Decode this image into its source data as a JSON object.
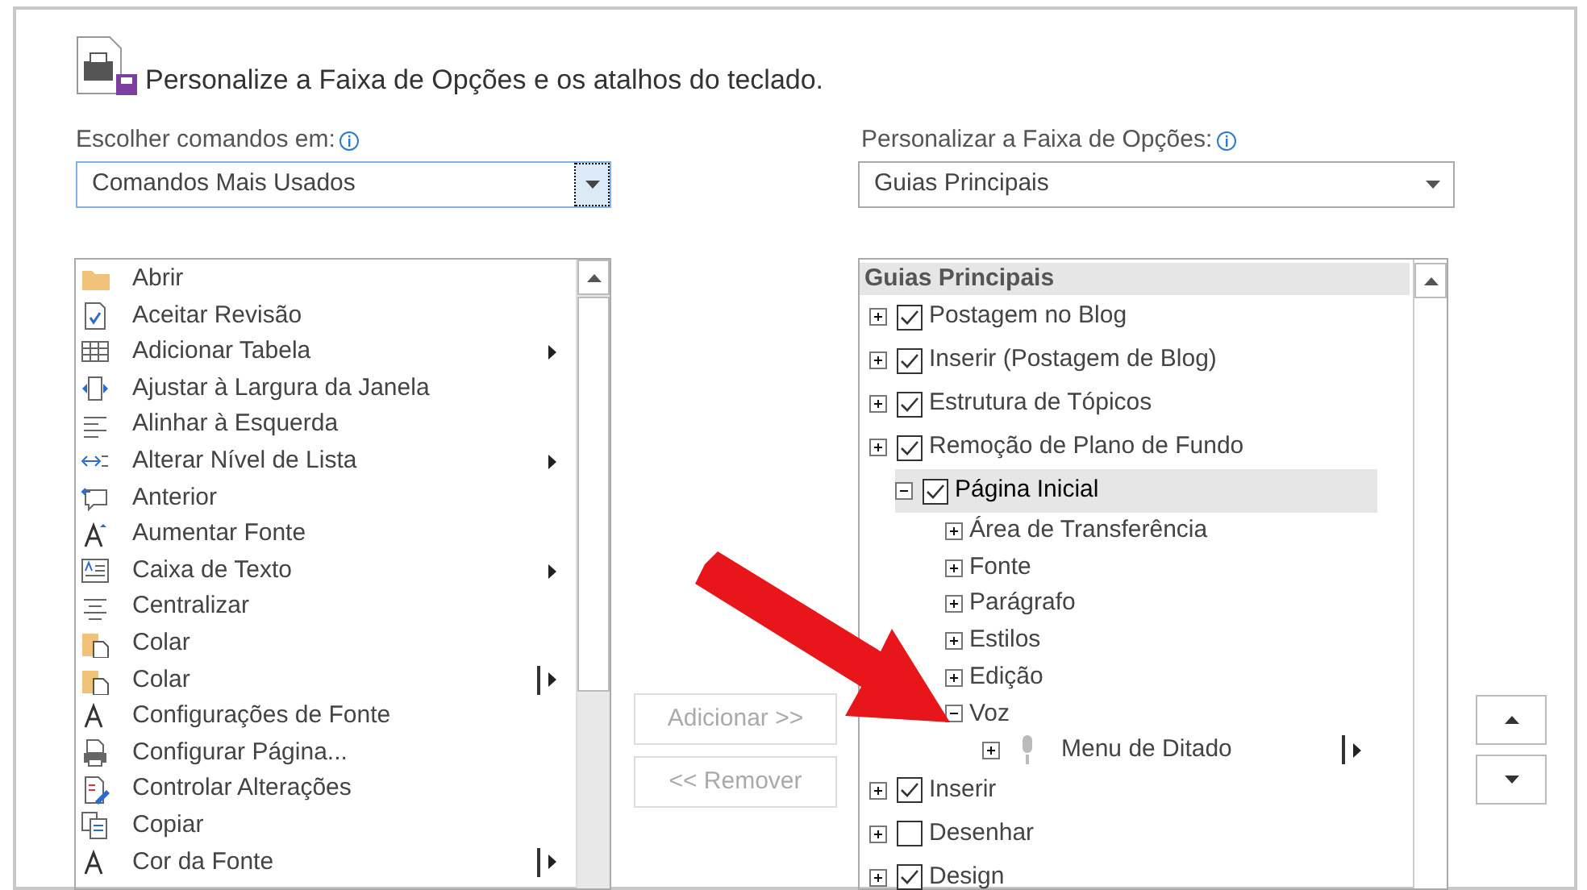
{
  "header": {
    "title": "Personalize a Faixa de Opções e os atalhos do teclado."
  },
  "commands_source": {
    "label": "Escolher comandos em:",
    "value": "Comandos Mais Usados"
  },
  "ribbon_target": {
    "label": "Personalizar a Faixa de Opções:",
    "value": "Guias Principais"
  },
  "commands": [
    {
      "label": "Abrir",
      "kind": "plain"
    },
    {
      "label": "Aceitar Revisão",
      "kind": "plain"
    },
    {
      "label": "Adicionar Tabela",
      "kind": "submenu"
    },
    {
      "label": "Ajustar à Largura da Janela",
      "kind": "plain"
    },
    {
      "label": "Alinhar à Esquerda",
      "kind": "plain"
    },
    {
      "label": "Alterar Nível de Lista",
      "kind": "submenu"
    },
    {
      "label": "Anterior",
      "kind": "plain"
    },
    {
      "label": "Aumentar Fonte",
      "kind": "plain"
    },
    {
      "label": "Caixa de Texto",
      "kind": "submenu"
    },
    {
      "label": "Centralizar",
      "kind": "plain"
    },
    {
      "label": "Colar",
      "kind": "plain"
    },
    {
      "label": "Colar",
      "kind": "split"
    },
    {
      "label": "Configurações de Fonte",
      "kind": "plain"
    },
    {
      "label": "Configurar Página...",
      "kind": "plain"
    },
    {
      "label": "Controlar Alterações",
      "kind": "plain"
    },
    {
      "label": "Copiar",
      "kind": "plain"
    },
    {
      "label": "Cor da Fonte",
      "kind": "split"
    }
  ],
  "actions": [
    {
      "label": "Adicionar >>",
      "disabled": true
    },
    {
      "label": "<< Remover",
      "disabled": true
    }
  ],
  "tree": {
    "heading": "Guias Principais",
    "items": [
      {
        "kind": "tab",
        "label": "Postagem no Blog",
        "checked": true,
        "expanded": false,
        "selected": false
      },
      {
        "kind": "tab",
        "label": "Inserir (Postagem de Blog)",
        "checked": true,
        "expanded": false,
        "selected": false
      },
      {
        "kind": "tab",
        "label": "Estrutura de Tópicos",
        "checked": true,
        "expanded": false,
        "selected": false
      },
      {
        "kind": "tab",
        "label": "Remoção de Plano de Fundo",
        "checked": true,
        "expanded": false,
        "selected": false
      },
      {
        "kind": "tab",
        "label": "Página Inicial",
        "checked": true,
        "expanded": true,
        "selected": true,
        "children": [
          {
            "kind": "group",
            "label": "Área de Transferência",
            "expanded": false,
            "selected": false
          },
          {
            "kind": "group",
            "label": "Fonte",
            "expanded": false,
            "selected": false
          },
          {
            "kind": "group",
            "label": "Parágrafo",
            "expanded": false,
            "selected": false
          },
          {
            "kind": "group",
            "label": "Estilos",
            "expanded": false,
            "selected": false
          },
          {
            "kind": "group",
            "label": "Edição",
            "expanded": false,
            "selected": false
          },
          {
            "kind": "group",
            "label": "Voz",
            "expanded": true,
            "selected": false,
            "children": [
              {
                "kind": "command",
                "label": "Menu de Ditado",
                "expanded": false,
                "selected": false
              }
            ]
          }
        ]
      },
      {
        "kind": "tab",
        "label": "Inserir",
        "checked": true,
        "expanded": false,
        "selected": false
      },
      {
        "kind": "tab",
        "label": "Desenhar",
        "checked": false,
        "expanded": false,
        "selected": false
      },
      {
        "kind": "tab",
        "label": "Design",
        "checked": true,
        "expanded": false,
        "selected": false
      }
    ]
  }
}
